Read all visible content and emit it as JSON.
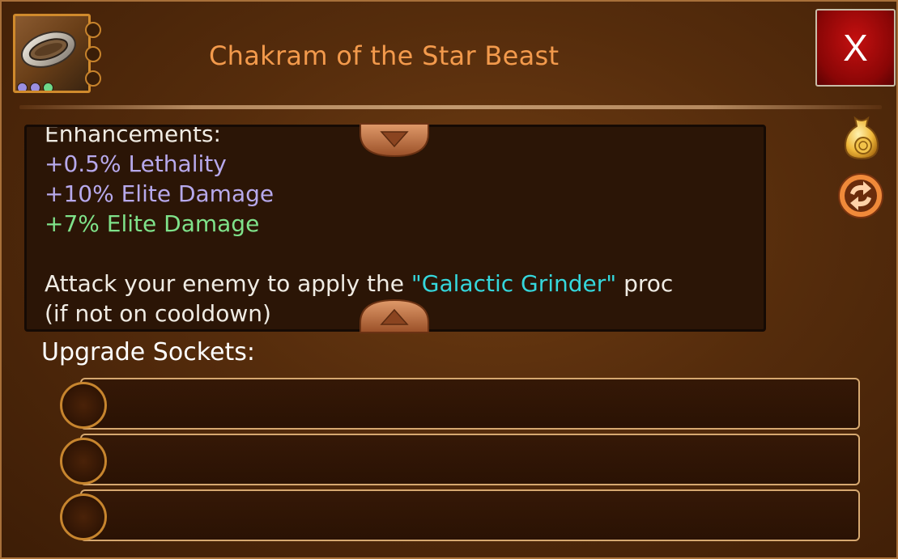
{
  "item": {
    "title": "Chakram of the Star Beast",
    "icon": "chakram-icon",
    "gem_colors": [
      "#9a8fe0",
      "#9a8fe0",
      "#6ed88a"
    ]
  },
  "close_label": "X",
  "description": {
    "enhancements_header": "Enhancements:",
    "stats": [
      {
        "text": "+0.5% Lethality",
        "color": "#b7a9ec"
      },
      {
        "text": "+10% Elite Damage",
        "color": "#b7a9ec"
      },
      {
        "text": "+7% Elite Damage",
        "color": "#7fe28a"
      }
    ],
    "proc_prefix": "Attack your enemy to apply the ",
    "proc_name": "\"Galactic Grinder\"",
    "proc_suffix": " proc",
    "proc_next_line": "(if not on cooldown)"
  },
  "side_icons": [
    "coin-bag-icon",
    "swap-icon"
  ],
  "sockets": {
    "label": "Upgrade Sockets:",
    "slots": [
      "",
      "",
      ""
    ]
  }
}
